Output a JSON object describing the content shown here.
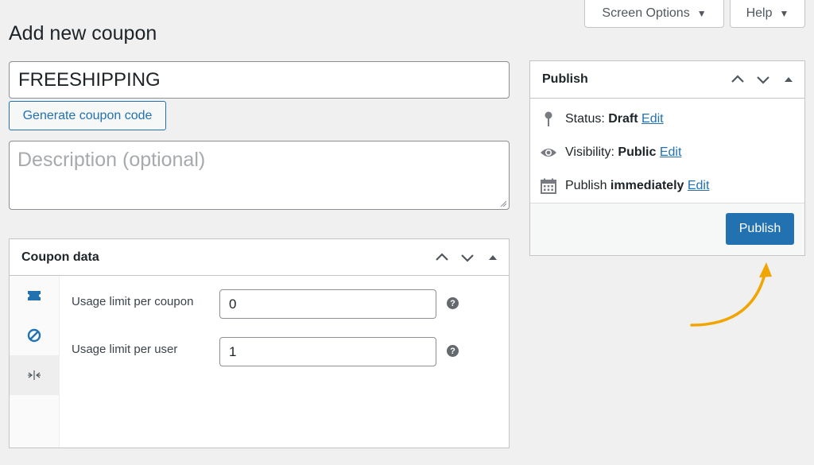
{
  "screen_tabs": {
    "screen_options_label": "Screen Options",
    "help_label": "Help"
  },
  "page_title": "Add new coupon",
  "coupon_code": {
    "value": "FREESHIPPING"
  },
  "generate_button_label": "Generate coupon code",
  "description": {
    "placeholder": "Description (optional)",
    "value": ""
  },
  "coupon_data": {
    "title": "Coupon data",
    "tabs": [
      {
        "icon": "ticket-icon",
        "active": false
      },
      {
        "icon": "restriction-icon",
        "active": false
      },
      {
        "icon": "usage-limits-icon",
        "active": true
      }
    ],
    "fields": [
      {
        "label": "Usage limit per coupon",
        "value": "0"
      },
      {
        "label": "Usage limit per user",
        "value": "1"
      }
    ],
    "help_glyph": "?"
  },
  "publish": {
    "title": "Publish",
    "status": {
      "prefix": "Status: ",
      "value": "Draft",
      "edit_label": "Edit"
    },
    "visibility": {
      "prefix": "Visibility: ",
      "value": "Public",
      "edit_label": "Edit"
    },
    "schedule": {
      "prefix": "Publish ",
      "value": "immediately",
      "edit_label": "Edit"
    },
    "button_label": "Publish"
  },
  "colors": {
    "accent": "#2271b1",
    "annotation_arrow": "#f0a500",
    "background": "#f0f0f1"
  }
}
